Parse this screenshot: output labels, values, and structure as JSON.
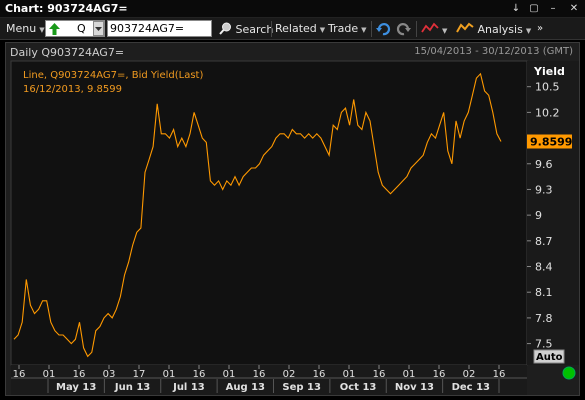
{
  "window": {
    "title": "Chart: 903724AG7=",
    "controls": [
      "↓",
      "▢",
      "–",
      "✕"
    ]
  },
  "toolbar": {
    "menu_label": "Menu",
    "quote_letter": "Q",
    "ric_value": "903724AG7=",
    "search_label": "Search",
    "related_label": "Related",
    "trade_label": "Trade",
    "analysis_label": "Analysis"
  },
  "chart_header": {
    "title": "Daily Q903724AG7=",
    "date_range": "15/04/2013 - 30/12/2013 (GMT)"
  },
  "legend": {
    "line1": "Line, Q903724AG7=, Bid Yield(Last)",
    "line2": "16/12/2013, 9.8599"
  },
  "auto_label": "Auto",
  "colors": {
    "line": "#ff9900",
    "last_value_bg": "#ff9900",
    "status_dot": "#00c000"
  },
  "chart_data": {
    "type": "line",
    "title": "Daily Q903724AG7=",
    "ylabel": "Yield",
    "ylim": [
      7.25,
      10.8
    ],
    "yticks": [
      7.5,
      7.8,
      8.1,
      8.4,
      8.7,
      9,
      9.3,
      9.6,
      9.9,
      10.2,
      10.5
    ],
    "ytick_labels": [
      "7.5",
      "7.8",
      "8.1",
      "8.4",
      "8.7",
      "9",
      "9.3",
      "9.6",
      "",
      "10.2",
      "10.5"
    ],
    "last_value": 9.8599,
    "last_value_label": "9.8599",
    "x_day_ticks": [
      "16",
      "01",
      "16",
      "03",
      "17",
      "01",
      "16",
      "01",
      "16",
      "02",
      "16",
      "01",
      "16",
      "01",
      "16",
      "02",
      "16"
    ],
    "x_month_labels": [
      "May 13",
      "Jun 13",
      "Jul 13",
      "Aug 13",
      "Sep 13",
      "Oct 13",
      "Nov 13",
      "Dec 13"
    ],
    "grid": false,
    "series": [
      {
        "values": [
          7.55,
          7.6,
          7.75,
          8.25,
          7.95,
          7.85,
          7.9,
          8.0,
          8.0,
          7.75,
          7.65,
          7.6,
          7.6,
          7.55,
          7.5,
          7.55,
          7.75,
          7.45,
          7.35,
          7.4,
          7.65,
          7.7,
          7.8,
          7.85,
          7.8,
          7.9,
          8.05,
          8.3,
          8.45,
          8.65,
          8.8,
          8.85,
          9.5,
          9.65,
          9.8,
          10.3,
          9.95,
          9.95,
          9.9,
          10.0,
          9.8,
          9.9,
          9.8,
          9.95,
          10.2,
          10.05,
          9.9,
          9.85,
          9.4,
          9.35,
          9.4,
          9.3,
          9.4,
          9.35,
          9.45,
          9.35,
          9.45,
          9.5,
          9.55,
          9.55,
          9.6,
          9.7,
          9.75,
          9.8,
          9.9,
          9.95,
          9.95,
          9.9,
          10.0,
          9.95,
          9.95,
          9.9,
          9.95,
          9.9,
          9.95,
          9.9,
          9.8,
          9.7,
          10.05,
          10.0,
          10.2,
          10.25,
          10.05,
          10.35,
          10.05,
          10.0,
          10.2,
          10.1,
          9.8,
          9.5,
          9.35,
          9.3,
          9.25,
          9.3,
          9.35,
          9.4,
          9.45,
          9.55,
          9.6,
          9.65,
          9.7,
          9.85,
          9.95,
          9.9,
          10.05,
          10.2,
          9.75,
          9.6,
          10.1,
          9.9,
          10.1,
          10.2,
          10.4,
          10.6,
          10.65,
          10.45,
          10.4,
          10.2,
          9.95,
          9.8599
        ]
      }
    ]
  }
}
